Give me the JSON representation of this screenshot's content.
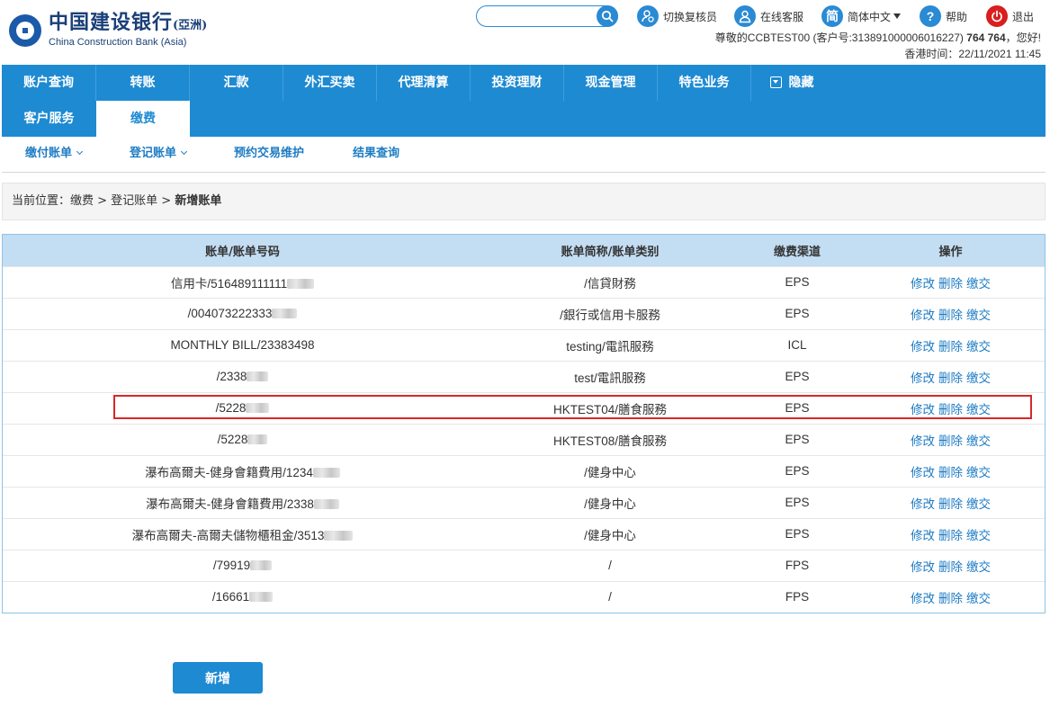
{
  "header": {
    "logo_cn": "中国建设银行",
    "logo_cn_suffix": "(亞洲)",
    "logo_en": "China Construction Bank (Asia)",
    "search": {
      "value": "",
      "placeholder": ""
    },
    "tools": {
      "switch_reviewer": "切换复核员",
      "online_service": "在线客服",
      "language": "简体中文",
      "language_icon_char": "简",
      "help": "帮助",
      "help_icon_char": "?",
      "logout": "退出"
    },
    "welcome_prefix": "尊敬的CCBTEST00 (客户号:313891000006016227) ",
    "welcome_name": "764 764",
    "welcome_suffix": "，您好!",
    "time_label": "香港时间：",
    "time_value": "22/11/2021 11:45"
  },
  "nav": {
    "items": [
      "账户查询",
      "转账",
      "汇款",
      "外汇买卖",
      "代理清算",
      "投资理财",
      "现金管理",
      "特色业务"
    ],
    "hide": "隐藏",
    "row2": [
      "客户服务",
      "缴费"
    ],
    "active": "缴费"
  },
  "subnav": {
    "items": [
      "缴付账单",
      "登记账单",
      "预约交易维护",
      "结果查询"
    ]
  },
  "breadcrumb": {
    "prefix": "当前位置：缴费 > 登记账单 > ",
    "current": "新增账单"
  },
  "table": {
    "headers": [
      "账单/账单号码",
      "账单简称/账单类别",
      "缴费渠道",
      "操作"
    ],
    "actions": [
      "修改",
      "删除",
      "缴交"
    ],
    "rows": [
      {
        "bill": "信用卡/516489111111",
        "name": "/信貸財務",
        "channel": "EPS"
      },
      {
        "bill": "/004073222333",
        "name": "/銀行或信用卡服務",
        "channel": "EPS"
      },
      {
        "bill": "MONTHLY BILL/23383498",
        "name": "testing/電訊服務",
        "channel": "ICL"
      },
      {
        "bill": "/2338",
        "name": "test/電訊服務",
        "channel": "EPS"
      },
      {
        "bill": "/5228",
        "name": "HKTEST04/膳食服務",
        "channel": "EPS"
      },
      {
        "bill": "/5228",
        "name": "HKTEST08/膳食服務",
        "channel": "EPS"
      },
      {
        "bill": "瀑布高爾夫-健身會籍費用/1234",
        "name": "/健身中心",
        "channel": "EPS"
      },
      {
        "bill": "瀑布高爾夫-健身會籍費用/2338",
        "name": "/健身中心",
        "channel": "EPS"
      },
      {
        "bill": "瀑布高爾夫-高爾夫儲物櫃租金/3513",
        "name": "/健身中心",
        "channel": "EPS"
      },
      {
        "bill": "/79919",
        "name": "/",
        "channel": "FPS"
      },
      {
        "bill": "/16661",
        "name": "/",
        "channel": "FPS"
      }
    ]
  },
  "add_button": "新增"
}
